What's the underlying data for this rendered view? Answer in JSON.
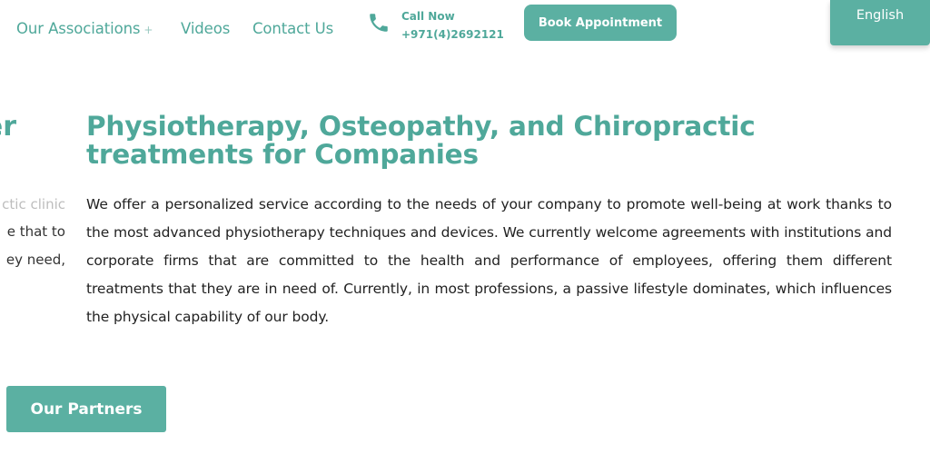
{
  "nav": {
    "associations": "Our Associations",
    "associations_plus": "+",
    "videos": "Videos",
    "contact": "Contact Us"
  },
  "call": {
    "label": "Call Now",
    "number": "+971(4)2692121",
    "icon": "phone-icon"
  },
  "book_button": "Book Appointment",
  "language": "English",
  "left_fragment": {
    "title": "er",
    "line1": "ctic clinic",
    "line2": "e that to",
    "line3": "ey need,"
  },
  "main": {
    "heading": "Physiotherapy, Osteopathy, and Chiropractic treatments for Companies",
    "paragraph": "We offer a personalized service according to the needs of your company to promote well-being at work thanks to the most advanced physiotherapy techniques and devices. We currently welcome agreements with institutions and corporate firms that are committed to the health and performance of employees, offering them different treatments that they are in need of. Currently, in most professions, a passive lifestyle dominates, which influences the physical capability of our body."
  },
  "partners_button": "Our Partners",
  "colors": {
    "accent": "#5bb0a2",
    "heading": "#4fa89a"
  }
}
